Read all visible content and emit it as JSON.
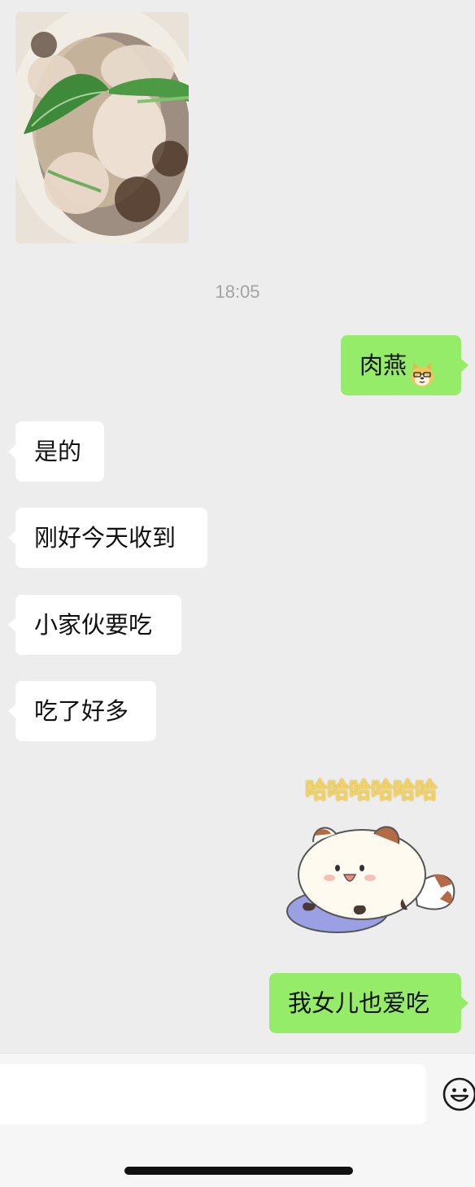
{
  "chat": {
    "photo": {
      "description_icon": "food-photo"
    },
    "timestamp": "18:05",
    "messages": [
      {
        "side": "out",
        "text": "肉燕",
        "emoji": "doge-emoji-icon"
      },
      {
        "side": "in",
        "text": "是的"
      },
      {
        "side": "in",
        "text": "刚好今天收到"
      },
      {
        "side": "in",
        "text": "小家伙要吃"
      },
      {
        "side": "in",
        "text": "吃了好多"
      },
      {
        "side": "out",
        "sticker_text": "哈哈哈哈哈哈"
      },
      {
        "side": "out",
        "text": "我女儿也爱吃"
      }
    ]
  },
  "input_bar": {
    "input_value": "",
    "emoji_icon": "smiley-icon"
  },
  "colors": {
    "background": "#ededed",
    "outgoing_bubble": "#95ec69",
    "incoming_bubble": "#ffffff",
    "timestamp": "#a3a3a3"
  }
}
